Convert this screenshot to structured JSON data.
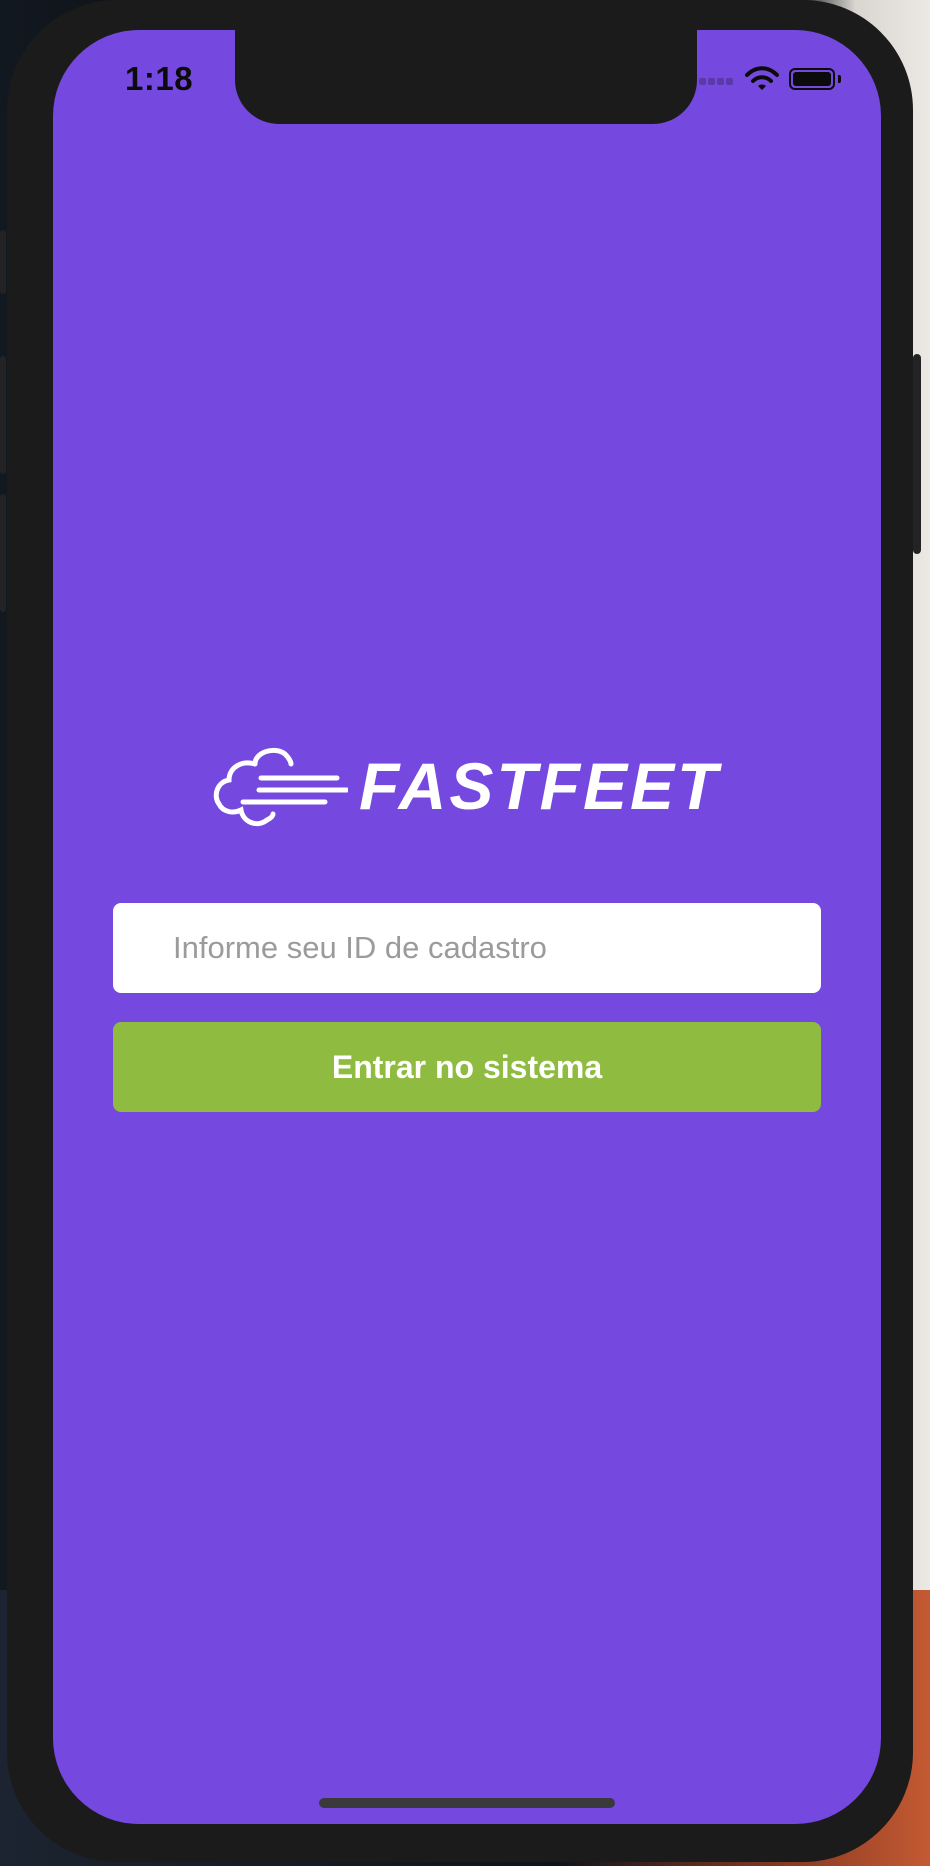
{
  "status_bar": {
    "time": "1:18",
    "signal_icon": "cellular-signal-icon",
    "wifi_icon": "wifi-icon",
    "battery_icon": "battery-icon",
    "battery_level": 1.0
  },
  "logo": {
    "brand_name": "FASTFEET",
    "icon": "cloud-speed-icon"
  },
  "login": {
    "id_placeholder": "Informe seu ID de cadastro",
    "id_value": "",
    "submit_label": "Entrar no sistema"
  },
  "colors": {
    "background": "#7549e0",
    "button": "#8fbc40",
    "input": "#ffffff",
    "text_on_brand": "#ffffff"
  }
}
